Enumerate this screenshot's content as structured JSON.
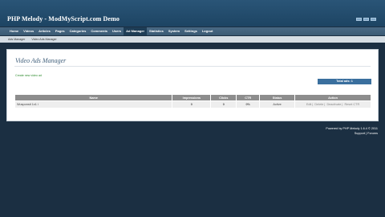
{
  "app": {
    "title": "PHP Melody - ModMyScript.com Demo"
  },
  "nav": {
    "items": [
      {
        "label": "Home"
      },
      {
        "label": "Videos"
      },
      {
        "label": "Articles"
      },
      {
        "label": "Pages"
      },
      {
        "label": "Categories"
      },
      {
        "label": "Comments"
      },
      {
        "label": "Users"
      },
      {
        "label": "Ad Manager"
      },
      {
        "label": "Statistics"
      },
      {
        "label": "System"
      },
      {
        "label": "Settings"
      },
      {
        "label": "Logout"
      }
    ],
    "active": "Ad Manager"
  },
  "subnav": {
    "items": [
      {
        "label": "Ads Manager"
      },
      {
        "label": "Video Ads Manager"
      }
    ]
  },
  "main": {
    "title": "Video Ads Manager",
    "create_link": "Create new video ad",
    "total": "Total ads: 1"
  },
  "table": {
    "headers": [
      "Name",
      "Impressions",
      "Clicks",
      "CTR",
      "Status",
      "Action"
    ],
    "rows": [
      {
        "name": "Wusponsit 1x1 i",
        "impressions": "0",
        "clicks": "0",
        "ctr": "0%",
        "status": "Active",
        "actions": [
          "Edit",
          "Delete",
          "Deactivate",
          "Reset CTR"
        ]
      }
    ]
  },
  "footer": {
    "powered": "Powered by PHP Melody 1.6.4 © 2011",
    "links": "Support | Forums"
  }
}
